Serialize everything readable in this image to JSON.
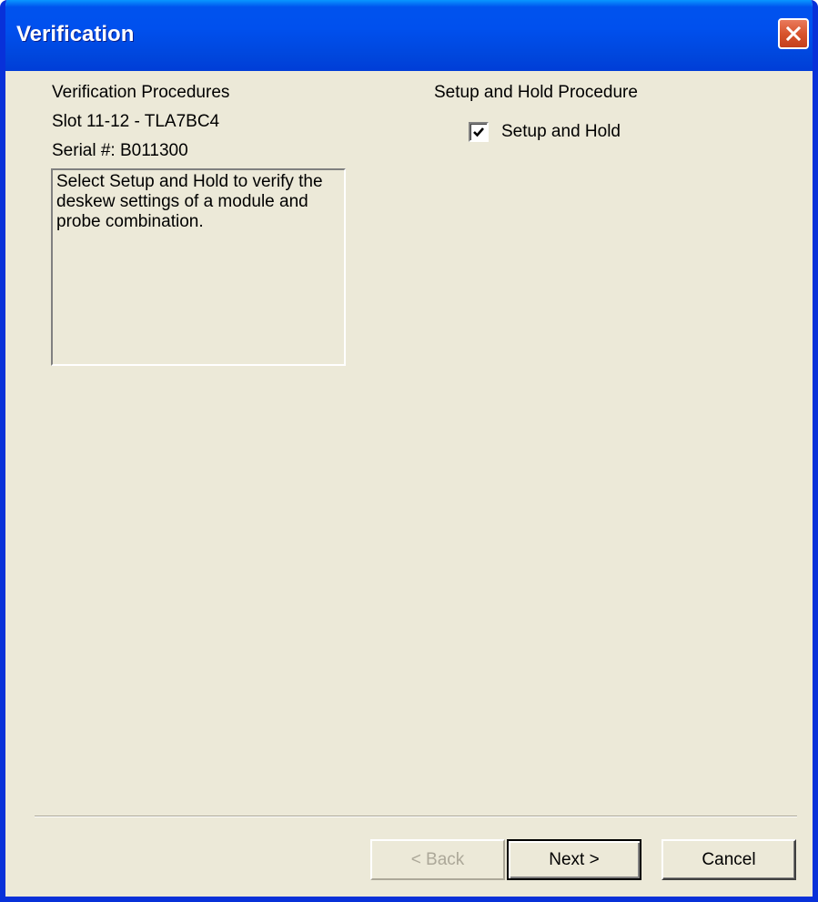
{
  "window": {
    "title": "Verification"
  },
  "left": {
    "heading": "Verification Procedures",
    "slot": "Slot 11-12 - TLA7BC4",
    "serial": "Serial #: B011300",
    "description": "Select Setup and Hold to verify the deskew settings of a module and probe combination."
  },
  "right": {
    "heading": "Setup and Hold Procedure",
    "checkbox_label": "Setup and Hold",
    "checkbox_checked": true
  },
  "buttons": {
    "back": "< Back",
    "next": "Next >",
    "cancel": "Cancel"
  },
  "icons": {
    "close": "close-icon",
    "check": "checkmark-icon"
  },
  "colors": {
    "titlebar": "#0054e3",
    "dialog_bg": "#ece9d8",
    "close_button": "#d8542e"
  }
}
